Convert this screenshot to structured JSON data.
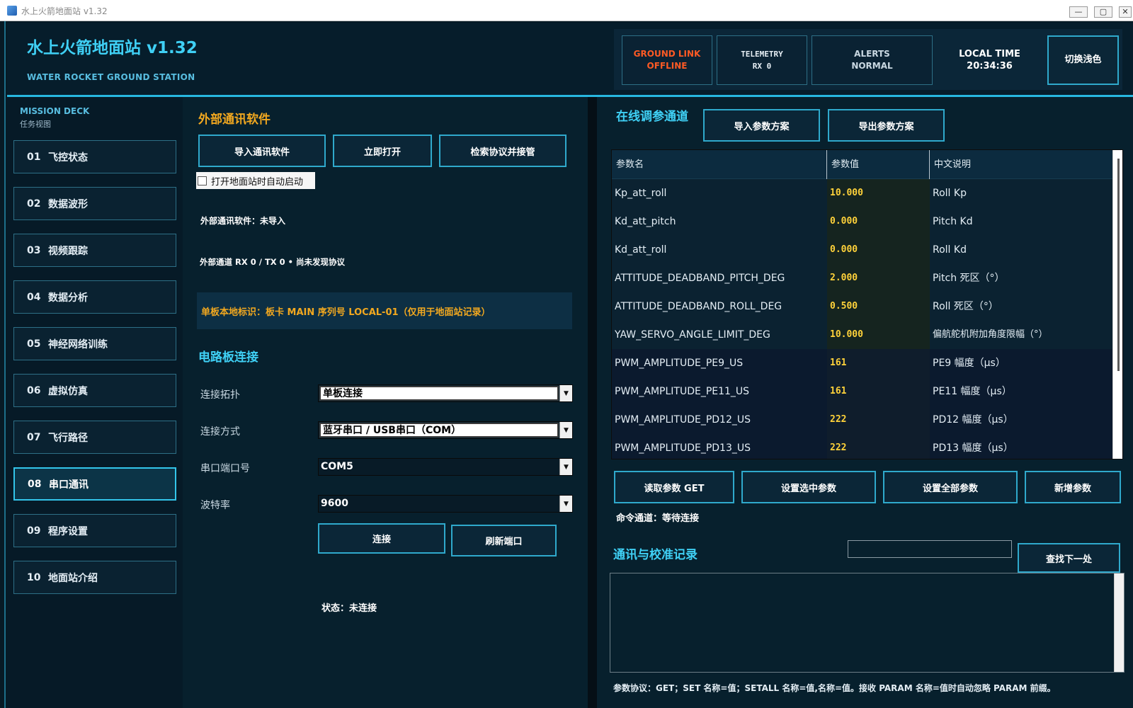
{
  "window": {
    "title": "水上火箭地面站 v1.32",
    "controls": {
      "minimize": "—",
      "maximize": "▢",
      "close": "✕"
    }
  },
  "header": {
    "title": "水上火箭地面站 v1.32",
    "subtitle": "WATER ROCKET GROUND STATION",
    "status": {
      "ground_link": [
        "GROUND LINK",
        "OFFLINE"
      ],
      "telemetry": [
        "TELEMETRY",
        "RX 0"
      ],
      "alerts": [
        "ALERTS",
        "NORMAL"
      ],
      "local_time": [
        "LOCAL TIME",
        "20:34:36"
      ]
    },
    "theme_button": "切换浅色",
    "colors": {
      "accent": "#3fd0f5",
      "offline": "#ff5a24",
      "warning": "#f2a81f"
    }
  },
  "sidebar": {
    "title": "MISSION DECK",
    "subtitle": "任务视图",
    "items": [
      {
        "num": "01",
        "label": "飞控状态"
      },
      {
        "num": "02",
        "label": "数据波形"
      },
      {
        "num": "03",
        "label": "视频跟踪"
      },
      {
        "num": "04",
        "label": "数据分析"
      },
      {
        "num": "05",
        "label": "神经网络训练"
      },
      {
        "num": "06",
        "label": "虚拟仿真"
      },
      {
        "num": "07",
        "label": "飞行路径"
      },
      {
        "num": "08",
        "label": "串口通讯"
      },
      {
        "num": "09",
        "label": "程序设置"
      },
      {
        "num": "10",
        "label": "地面站介绍"
      }
    ],
    "active_index": 7
  },
  "external": {
    "title": "外部通讯软件",
    "buttons": {
      "import": "导入通讯软件",
      "open_now": "立即打开",
      "detect": "检索协议并接管"
    },
    "autostart_label": "打开地面站时自动启动",
    "autostart_checked": false,
    "status": "外部通讯软件：未导入",
    "channel": "外部通道 RX 0 / TX 0 • 尚未发现协议",
    "board_id": "单板本地标识：板卡 MAIN   序列号 LOCAL-01（仅用于地面站记录）"
  },
  "board": {
    "title": "电路板连接",
    "fields": {
      "topology": {
        "label": "连接拓扑",
        "value": "单板连接"
      },
      "method": {
        "label": "连接方式",
        "value": "蓝牙串口 / USB串口（COM）"
      },
      "port": {
        "label": "串口端口号",
        "value": "COM5"
      },
      "baud": {
        "label": "波特率",
        "value": "9600"
      }
    },
    "buttons": {
      "connect": "连接",
      "refresh": "刷新端口"
    },
    "state": "状态：未连接"
  },
  "tuning": {
    "title": "在线调参通道",
    "buttons": {
      "import_scheme": "导入参数方案",
      "export_scheme": "导出参数方案"
    },
    "columns": [
      "参数名",
      "参数值",
      "中文说明"
    ],
    "rows": [
      {
        "name": "Kp_att_roll",
        "value": "10.000",
        "desc": "Roll Kp"
      },
      {
        "name": "Kd_att_pitch",
        "value": "0.000",
        "desc": "Pitch Kd"
      },
      {
        "name": "Kd_att_roll",
        "value": "0.000",
        "desc": "Roll Kd"
      },
      {
        "name": "ATTITUDE_DEADBAND_PITCH_DEG",
        "value": "2.000",
        "desc": "Pitch 死区（°）"
      },
      {
        "name": "ATTITUDE_DEADBAND_ROLL_DEG",
        "value": "0.500",
        "desc": "Roll 死区（°）"
      },
      {
        "name": "YAW_SERVO_ANGLE_LIMIT_DEG",
        "value": "10.000",
        "desc": "偏航舵机附加角度限幅（°）"
      },
      {
        "name": "PWM_AMPLITUDE_PE9_US",
        "value": "161",
        "desc": "PE9 幅度（μs）"
      },
      {
        "name": "PWM_AMPLITUDE_PE11_US",
        "value": "161",
        "desc": "PE11 幅度（μs）"
      },
      {
        "name": "PWM_AMPLITUDE_PD12_US",
        "value": "222",
        "desc": "PD12 幅度（μs）"
      },
      {
        "name": "PWM_AMPLITUDE_PD13_US",
        "value": "222",
        "desc": "PD13 幅度（μs）"
      }
    ],
    "actions": {
      "get": "读取参数 GET",
      "set_selected": "设置选中参数",
      "set_all": "设置全部参数",
      "add": "新增参数"
    },
    "command_status": "命令通道：等待连接"
  },
  "log": {
    "title": "通讯与校准记录",
    "search_placeholder": "",
    "find_next": "查找下一处",
    "protocol_note": "参数协议：GET；SET 名称=值；SETALL 名称=值,名称=值。接收 PARAM 名称=值时自动忽略 PARAM 前缀。"
  }
}
